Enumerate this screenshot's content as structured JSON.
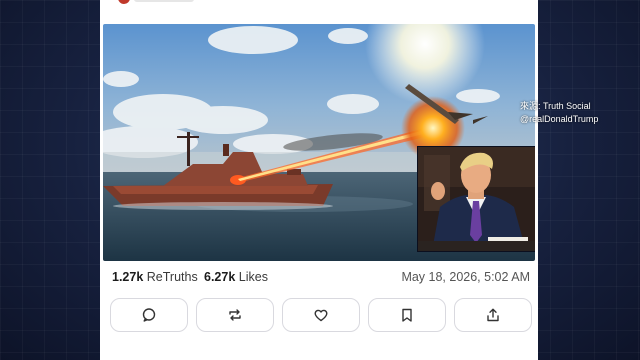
{
  "post": {
    "retruths_count": "1.27k",
    "retruths_label": "ReTruths",
    "likes_count": "6.27k",
    "likes_label": "Likes",
    "timestamp": "May 18, 2026, 5:02 AM"
  },
  "actions": [
    {
      "icon": "reply-icon"
    },
    {
      "icon": "retruth-icon"
    },
    {
      "icon": "like-icon"
    },
    {
      "icon": "bookmark-icon"
    },
    {
      "icon": "share-icon"
    }
  ],
  "watermark": {
    "line1": "來源: Truth Social",
    "line2": "@realDonaldTrump"
  },
  "colors": {
    "background": "#17213f",
    "card": "#ffffff",
    "button_border": "#d9d9df",
    "suit": "#1e2a4a",
    "tie": "#6a3fa0"
  }
}
